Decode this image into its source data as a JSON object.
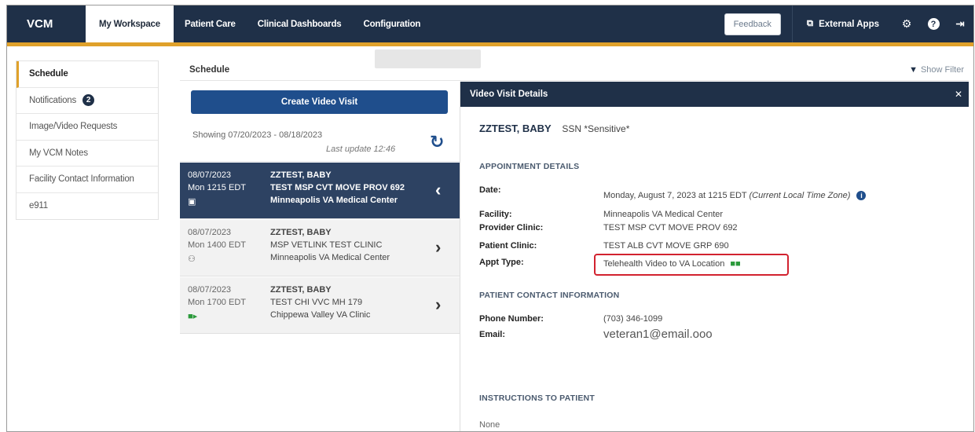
{
  "app": {
    "brand": "VCM"
  },
  "nav": {
    "tabs": [
      "My Workspace",
      "Patient Care",
      "Clinical Dashboards",
      "Configuration"
    ],
    "feedback": "Feedback",
    "external_apps": "External Apps"
  },
  "sidebar": {
    "items": [
      {
        "label": "Schedule"
      },
      {
        "label": "Notifications",
        "badge": "2"
      },
      {
        "label": "Image/Video Requests"
      },
      {
        "label": "My VCM Notes"
      },
      {
        "label": "Facility Contact Information"
      },
      {
        "label": "e911"
      }
    ]
  },
  "schedule": {
    "title": "Schedule",
    "show_filter": "Show Filter",
    "create_button": "Create Video Visit",
    "showing": "Showing 07/20/2023 - 08/18/2023",
    "last_update": "Last update 12:46"
  },
  "appointments": [
    {
      "date": "08/07/2023",
      "time": "Mon 1215 EDT",
      "name": "ZZTEST, BABY",
      "clinic": "TEST MSP CVT MOVE PROV 692",
      "facility": "Minneapolis VA Medical Center",
      "icon": "video-to-va-icon"
    },
    {
      "date": "08/07/2023",
      "time": "Mon 1400 EDT",
      "name": "ZZTEST, BABY",
      "clinic": "MSP VETLINK TEST CLINIC",
      "facility": "Minneapolis VA Medical Center",
      "icon": "people-icon"
    },
    {
      "date": "08/07/2023",
      "time": "Mon 1700 EDT",
      "name": "ZZTEST, BABY",
      "clinic": "TEST CHI VVC MH 179",
      "facility": "Chippewa Valley VA Clinic",
      "icon": "video-camera-icon"
    }
  ],
  "detail": {
    "title": "Video Visit Details",
    "patient_name": "ZZTEST, BABY",
    "ssn": "SSN *Sensitive*",
    "appointment_section": "APPOINTMENT DETAILS",
    "date_label": "Date:",
    "date_value": "Monday, August 7, 2023 at 1215 EDT",
    "date_tz": "(Current Local Time Zone)",
    "facility_label": "Facility:",
    "facility_value": "Minneapolis VA Medical Center",
    "provider_clinic_label": "Provider Clinic:",
    "provider_clinic_value": "TEST MSP CVT MOVE PROV 692",
    "patient_clinic_label": "Patient Clinic:",
    "patient_clinic_value": "TEST ALB CVT MOVE GRP 690",
    "appt_type_label": "Appt Type:",
    "appt_type_value": "Telehealth Video to VA Location",
    "contact_section": "PATIENT CONTACT INFORMATION",
    "phone_label": "Phone Number:",
    "phone_value": "(703) 346-1099",
    "email_label": "Email:",
    "email_value": "veteran1@email.ooo",
    "instructions_section": "INSTRUCTIONS TO PATIENT",
    "instructions_value": "None"
  },
  "colors": {
    "navbar": "#1f3048",
    "accent_gold": "#e0a12a",
    "primary_button": "#1f4e8c",
    "selected_row": "#2d4262",
    "highlight_border": "#d2222f"
  }
}
